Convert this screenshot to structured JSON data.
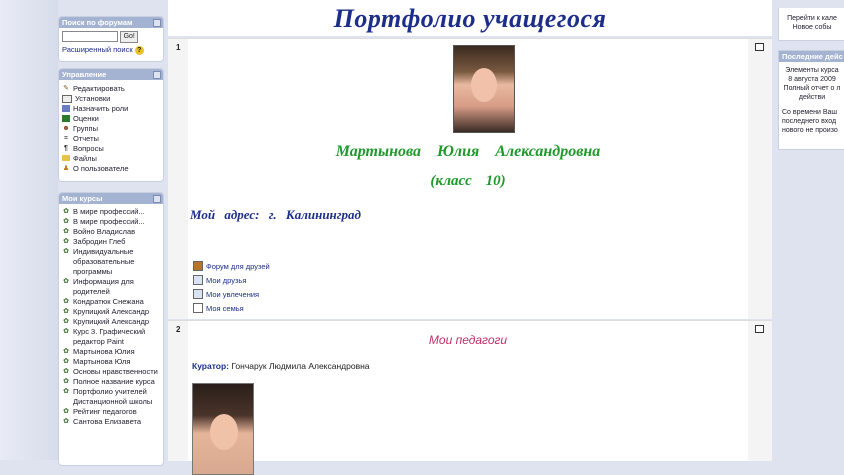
{
  "sidebar": {
    "search": {
      "title": "Поиск по форумам",
      "go_label": "Go!",
      "advanced_label": "Расширенный поиск",
      "help_icon": "?"
    },
    "admin": {
      "title": "Управление",
      "items": [
        {
          "label": "Редактировать",
          "icon": "edit-icon"
        },
        {
          "label": "Установки",
          "icon": "settings-icon"
        },
        {
          "label": "Назначить роли",
          "icon": "roles-icon"
        },
        {
          "label": "Оценки",
          "icon": "grades-icon"
        },
        {
          "label": "Группы",
          "icon": "groups-icon"
        },
        {
          "label": "Отчеты",
          "icon": "reports-icon"
        },
        {
          "label": "Вопросы",
          "icon": "questions-icon"
        },
        {
          "label": "Файлы",
          "icon": "files-icon"
        },
        {
          "label": "О пользователе",
          "icon": "user-icon"
        }
      ]
    },
    "courses": {
      "title": "Мои курсы",
      "items": [
        "В мире профессий...",
        "В мире профессий...",
        "Войно Владислав",
        "Забродин Глеб",
        "Индивидуальные образовательные программы",
        "Информация для родителей",
        "Кондратюк Снежана",
        "Крупицкий Александр",
        "Крупицкий Александр",
        "Курс 3. Графический редактор Paint",
        "Мартынова Юлия",
        "Мартынова Юля",
        "Основы нравственности",
        "Полное название курса",
        "Портфолио учителей Дистанционной школы",
        "Рейтинг педагогов",
        "Сантова Елизавета"
      ]
    }
  },
  "main": {
    "title": "Портфолио учащегося",
    "section1": {
      "number": "1",
      "name": "Мартынова Юлия Александровна",
      "klass": "(класс 10)",
      "address": "Мой адрес: г. Калининград",
      "links": [
        {
          "label": "Форум для друзей",
          "icon": "forum-icon"
        },
        {
          "label": "Мои друзья",
          "icon": "page-icon"
        },
        {
          "label": "Мои увлечения",
          "icon": "page-icon"
        },
        {
          "label": "Моя семья",
          "icon": "document-icon"
        }
      ]
    },
    "section2": {
      "number": "2",
      "title": "Мои педагоги",
      "curator_label": "Куратор:",
      "curator_name": "Гончарук Людмила Александровна"
    }
  },
  "right": {
    "calendar": {
      "line1": "Перейти к кале",
      "line2": "Новое собы"
    },
    "recent": {
      "title": "Последние дейс",
      "text1": "Элементы курса",
      "text2": "8 августа 2009",
      "text3": "Полный отчет о л",
      "text4": "действи",
      "text5": "Со времени Ваш",
      "text6": "последнего вход",
      "text7": "нового не произо"
    }
  }
}
